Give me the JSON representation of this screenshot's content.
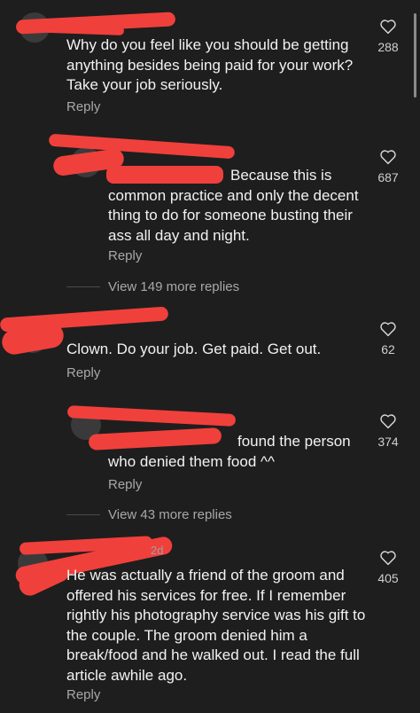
{
  "comments": [
    {
      "text": "Why do you feel like you should be getting anything besides being paid for your work?  Take your job seriously.",
      "reply": "Reply",
      "likes": "288"
    },
    {
      "text": "Because this is common practice and only the decent thing to do for someone busting their ass all day and night.",
      "reply": "Reply",
      "likes": "687",
      "view_more": "View 149 more replies"
    },
    {
      "text": "Clown.  Do your job. Get paid.  Get out.",
      "reply": "Reply",
      "likes": "62"
    },
    {
      "text": "found the person who denied them food ^^",
      "reply": "Reply",
      "likes": "374",
      "view_more": "View 43 more replies"
    },
    {
      "text": "He was actually a friend of the groom and offered his services for free. If I remember rightly his photography service was his gift to the couple. The groom denied him a break/food and he walked out. I read the full article awhile ago.",
      "reply": "Reply",
      "likes": "405",
      "time": "2d"
    }
  ],
  "icons": {
    "like": "heart-icon"
  },
  "colors": {
    "background": "#1e1e1e",
    "text": "#f2f2f2",
    "muted": "#a8a8a8",
    "redaction": "#f0403c"
  }
}
